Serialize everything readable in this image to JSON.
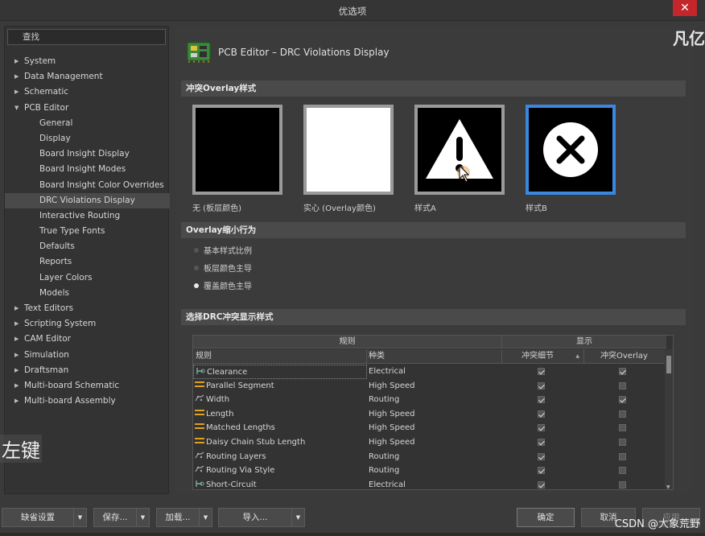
{
  "window": {
    "title": "优选项",
    "close_glyph": "✕"
  },
  "search": {
    "label": "查找"
  },
  "tree": [
    {
      "label": "System",
      "level": 0,
      "arrow": "▶"
    },
    {
      "label": "Data Management",
      "level": 0,
      "arrow": "▶"
    },
    {
      "label": "Schematic",
      "level": 0,
      "arrow": "▶"
    },
    {
      "label": "PCB Editor",
      "level": 0,
      "arrow": "▼"
    },
    {
      "label": "General",
      "level": 1
    },
    {
      "label": "Display",
      "level": 1
    },
    {
      "label": "Board Insight Display",
      "level": 1
    },
    {
      "label": "Board Insight Modes",
      "level": 1
    },
    {
      "label": "Board Insight Color Overrides",
      "level": 1
    },
    {
      "label": "DRC Violations Display",
      "level": 1,
      "selected": true
    },
    {
      "label": "Interactive Routing",
      "level": 1
    },
    {
      "label": "True Type Fonts",
      "level": 1
    },
    {
      "label": "Defaults",
      "level": 1
    },
    {
      "label": "Reports",
      "level": 1
    },
    {
      "label": "Layer Colors",
      "level": 1
    },
    {
      "label": "Models",
      "level": 1
    },
    {
      "label": "Text Editors",
      "level": 0,
      "arrow": "▶"
    },
    {
      "label": "Scripting System",
      "level": 0,
      "arrow": "▶"
    },
    {
      "label": "CAM Editor",
      "level": 0,
      "arrow": "▶"
    },
    {
      "label": "Simulation",
      "level": 0,
      "arrow": "▶"
    },
    {
      "label": "Draftsman",
      "level": 0,
      "arrow": "▶"
    },
    {
      "label": "Multi-board Schematic",
      "level": 0,
      "arrow": "▶"
    },
    {
      "label": "Multi-board Assembly",
      "level": 0,
      "arrow": "▶"
    }
  ],
  "main": {
    "title": "PCB Editor – DRC Violations Display",
    "section_overlay_style": "冲突Overlay样式",
    "styles": [
      {
        "label": "无 (板层颜色)"
      },
      {
        "label": "实心 (Overlay颜色)"
      },
      {
        "label": "样式A"
      },
      {
        "label": "样式B",
        "selected": true
      }
    ],
    "section_overlay_zoom": "Overlay缩小行为",
    "radios": [
      {
        "label": "基本样式比例",
        "checked": false
      },
      {
        "label": "板层颜色主导",
        "checked": false
      },
      {
        "label": "覆盖颜色主导",
        "checked": true
      }
    ],
    "section_drc": "选择DRC冲突显示样式",
    "grid": {
      "group_rule": "规则",
      "group_display": "显示",
      "col_rule": "规则",
      "col_type": "种类",
      "col_detail": "冲突细节",
      "col_overlay": "冲突Overlay",
      "sort_glyph": "▲",
      "rows": [
        {
          "rule": "Clearance",
          "type": "Electrical",
          "icon": "clearance",
          "detail": true,
          "overlay": true
        },
        {
          "rule": "Parallel Segment",
          "type": "High Speed",
          "icon": "highspeed",
          "detail": true,
          "overlay": false
        },
        {
          "rule": "Width",
          "type": "Routing",
          "icon": "routing",
          "detail": true,
          "overlay": true
        },
        {
          "rule": "Length",
          "type": "High Speed",
          "icon": "highspeed",
          "detail": true,
          "overlay": false
        },
        {
          "rule": "Matched Lengths",
          "type": "High Speed",
          "icon": "highspeed",
          "detail": true,
          "overlay": false
        },
        {
          "rule": "Daisy Chain Stub Length",
          "type": "High Speed",
          "icon": "highspeed",
          "detail": true,
          "overlay": false
        },
        {
          "rule": "Routing Layers",
          "type": "Routing",
          "icon": "routing",
          "detail": true,
          "overlay": false
        },
        {
          "rule": "Routing Via Style",
          "type": "Routing",
          "icon": "routing",
          "detail": true,
          "overlay": false
        },
        {
          "rule": "Short-Circuit",
          "type": "Electrical",
          "icon": "clearance",
          "detail": true,
          "overlay": false
        }
      ]
    }
  },
  "buttons": {
    "defaults": "缺省设置",
    "save": "保存...",
    "load": "加载...",
    "import": "导入...",
    "ok": "确定",
    "cancel": "取消",
    "apply": "应用",
    "dropdown_glyph": "▼"
  },
  "watermarks": {
    "top_right": "凡亿",
    "left": "左键",
    "bottom_right": "CSDN @大象荒野"
  },
  "colors": {
    "selected_border": "#3a87e0",
    "close_red": "#c4262b"
  }
}
